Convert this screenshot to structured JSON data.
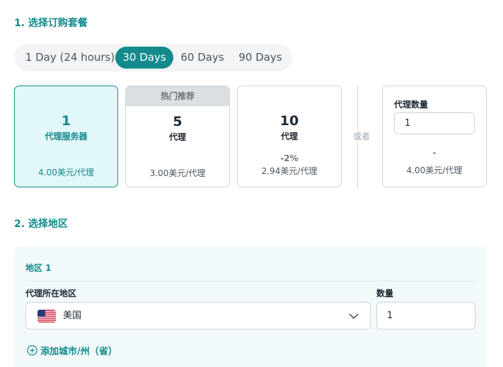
{
  "section1": {
    "title": "1. 选择订购套餐"
  },
  "durations": {
    "tabs": [
      "1 Day (24 hours)",
      "30 Days",
      "60 Days",
      "90 Days"
    ],
    "selected": "30 Days"
  },
  "plans": [
    {
      "count": "1",
      "unit": "代理服务器",
      "discount": "",
      "price": "4.00美元/代理",
      "badge": "",
      "selected": true
    },
    {
      "count": "5",
      "unit": "代理",
      "discount": "",
      "price": "3.00美元/代理",
      "badge": "热门推荐",
      "selected": false
    },
    {
      "count": "10",
      "unit": "代理",
      "discount": "-2%",
      "price": "2.94美元/代理",
      "badge": "",
      "selected": false
    }
  ],
  "or_label": "或者",
  "custom": {
    "label": "代理数量",
    "value": "1",
    "discount": "-",
    "price": "4.00美元/代理"
  },
  "section2": {
    "title": "2. 选择地区"
  },
  "region": {
    "title": "地区 1",
    "location_label": "代理所在地区",
    "location_value": "美国",
    "flag_icon": "us-flag-icon",
    "quantity_label": "数量",
    "quantity_value": "1",
    "add_link": "添加城市/州（省）"
  },
  "colors": {
    "accent": "#138a8c",
    "selected_bg": "#e2f7f8",
    "region_bg": "#f1f9fa"
  }
}
